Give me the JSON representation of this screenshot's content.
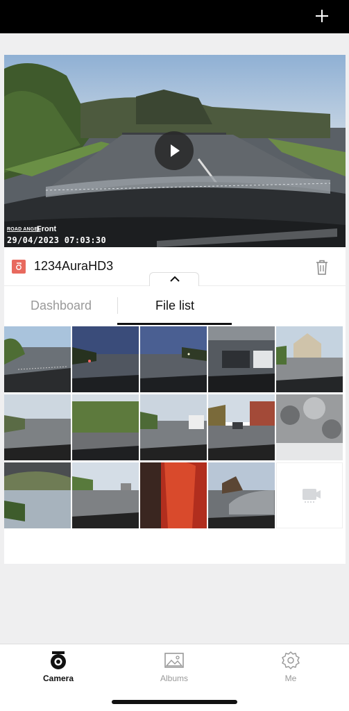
{
  "topbar": {
    "add_icon": "plus-icon"
  },
  "player": {
    "overlay_brand": "ROAD ANGEL",
    "overlay_camera": "Front",
    "overlay_timestamp": "29/04/2023  07:03:30",
    "play_icon": "play-icon"
  },
  "device": {
    "name": "1234AuraHD3",
    "icon": "camera-device-icon",
    "accent": "#e8695e"
  },
  "tabs": [
    {
      "label": "Dashboard",
      "active": false
    },
    {
      "label": "File list",
      "active": true
    }
  ],
  "thumbnails": [
    {
      "scene": "roundabout daytime"
    },
    {
      "scene": "night road"
    },
    {
      "scene": "night road lights"
    },
    {
      "scene": "car park interior"
    },
    {
      "scene": "residential house"
    },
    {
      "scene": "country road"
    },
    {
      "scene": "hedgerow"
    },
    {
      "scene": "street parked cars"
    },
    {
      "scene": "red building"
    },
    {
      "scene": "blurred close-up"
    },
    {
      "scene": "upside down view"
    },
    {
      "scene": "open lane"
    },
    {
      "scene": "red obstruction"
    },
    {
      "scene": "parked grey car"
    },
    {
      "scene": "video placeholder"
    }
  ],
  "bottom_nav": [
    {
      "label": "Camera",
      "icon": "camera-icon",
      "active": true
    },
    {
      "label": "Albums",
      "icon": "albums-icon",
      "active": false
    },
    {
      "label": "Me",
      "icon": "gear-icon",
      "active": false
    }
  ]
}
